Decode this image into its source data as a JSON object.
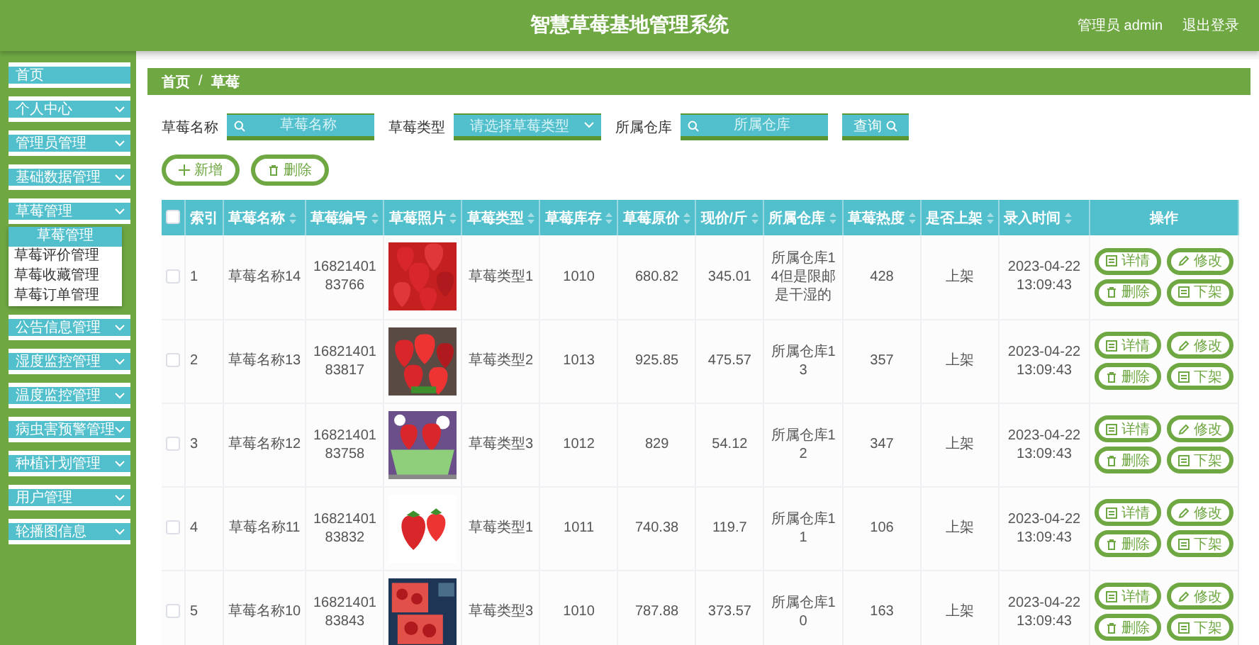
{
  "header": {
    "title": "智慧草莓基地管理系统",
    "user": "管理员 admin",
    "logout": "退出登录"
  },
  "sidebar": {
    "items": [
      {
        "label": "首页",
        "expandable": false
      },
      {
        "label": "个人中心",
        "expandable": true
      },
      {
        "label": "管理员管理",
        "expandable": true
      },
      {
        "label": "基础数据管理",
        "expandable": true
      },
      {
        "label": "草莓管理",
        "expandable": true,
        "children": [
          {
            "label": "草莓管理",
            "selected": true
          },
          {
            "label": "草莓评价管理",
            "selected": false
          },
          {
            "label": "草莓收藏管理",
            "selected": false
          },
          {
            "label": "草莓订单管理",
            "selected": false
          }
        ]
      },
      {
        "label": "公告信息管理",
        "expandable": true
      },
      {
        "label": "湿度监控管理",
        "expandable": true
      },
      {
        "label": "温度监控管理",
        "expandable": true
      },
      {
        "label": "病虫害预警管理",
        "expandable": true
      },
      {
        "label": "种植计划管理",
        "expandable": true
      },
      {
        "label": "用户管理",
        "expandable": true
      },
      {
        "label": "轮播图信息",
        "expandable": true
      }
    ]
  },
  "breadcrumb": {
    "items": [
      "首页",
      "草莓"
    ],
    "separator": "/"
  },
  "search": {
    "fields": [
      {
        "kind": "input",
        "label": "草莓名称",
        "placeholder": "草莓名称"
      },
      {
        "kind": "select",
        "label": "草莓类型",
        "placeholder": "请选择草莓类型"
      },
      {
        "kind": "input",
        "label": "所属仓库",
        "placeholder": "所属仓库"
      }
    ],
    "button": "查询"
  },
  "toolbar": [
    {
      "kind": "add",
      "label": "新增"
    },
    {
      "kind": "delete",
      "label": "删除"
    }
  ],
  "table": {
    "all_checked": false,
    "columns": [
      {
        "label": "索引",
        "sortable": false
      },
      {
        "label": "草莓名称",
        "sortable": true
      },
      {
        "label": "草莓编号",
        "sortable": true
      },
      {
        "label": "草莓照片",
        "sortable": true
      },
      {
        "label": "草莓类型",
        "sortable": true
      },
      {
        "label": "草莓库存",
        "sortable": true
      },
      {
        "label": "草莓原价",
        "sortable": true
      },
      {
        "label": "现价/斤",
        "sortable": true
      },
      {
        "label": "所属仓库",
        "sortable": true
      },
      {
        "label": "草莓热度",
        "sortable": true
      },
      {
        "label": "是否上架",
        "sortable": true
      },
      {
        "label": "录入时间",
        "sortable": true
      },
      {
        "label": "操作",
        "sortable": false
      }
    ],
    "rows": [
      {
        "checked": false,
        "cells": [
          "1",
          "草莓名称14",
          "1682140183766",
          {
            "kind": "picture"
          },
          "草莓类型1",
          "1010",
          "680.82",
          "345.01",
          "所属仓库14但是限邮是干湿的",
          "428",
          "上架",
          "2023-04-22 13:09:43"
        ],
        "actions": [
          {
            "kind": "detail",
            "label": "详情"
          },
          {
            "kind": "edit",
            "label": "修改"
          },
          {
            "kind": "delete",
            "label": "删除"
          },
          {
            "kind": "offshelf",
            "label": "下架"
          }
        ]
      },
      {
        "checked": false,
        "cells": [
          "2",
          "草莓名称13",
          "1682140183817",
          {
            "kind": "picture"
          },
          "草莓类型2",
          "1013",
          "925.85",
          "475.57",
          "所属仓库13",
          "357",
          "上架",
          "2023-04-22 13:09:43"
        ],
        "actions": [
          {
            "kind": "detail",
            "label": "详情"
          },
          {
            "kind": "edit",
            "label": "修改"
          },
          {
            "kind": "delete",
            "label": "删除"
          },
          {
            "kind": "offshelf",
            "label": "下架"
          }
        ]
      },
      {
        "checked": false,
        "cells": [
          "3",
          "草莓名称12",
          "1682140183758",
          {
            "kind": "picture"
          },
          "草莓类型3",
          "1012",
          "829",
          "54.12",
          "所属仓库12",
          "347",
          "上架",
          "2023-04-22 13:09:43"
        ],
        "actions": [
          {
            "kind": "detail",
            "label": "详情"
          },
          {
            "kind": "edit",
            "label": "修改"
          },
          {
            "kind": "delete",
            "label": "删除"
          },
          {
            "kind": "offshelf",
            "label": "下架"
          }
        ]
      },
      {
        "checked": false,
        "cells": [
          "4",
          "草莓名称11",
          "1682140183832",
          {
            "kind": "picture"
          },
          "草莓类型1",
          "1011",
          "740.38",
          "119.7",
          "所属仓库11",
          "106",
          "上架",
          "2023-04-22 13:09:43"
        ],
        "actions": [
          {
            "kind": "detail",
            "label": "详情"
          },
          {
            "kind": "edit",
            "label": "修改"
          },
          {
            "kind": "delete",
            "label": "删除"
          },
          {
            "kind": "offshelf",
            "label": "下架"
          }
        ]
      },
      {
        "checked": false,
        "cells": [
          "5",
          "草莓名称10",
          "1682140183843",
          {
            "kind": "picture"
          },
          "草莓类型3",
          "1010",
          "787.88",
          "373.57",
          "所属仓库10",
          "163",
          "上架",
          "2023-04-22 13:09:43"
        ],
        "actions": [
          {
            "kind": "detail",
            "label": "详情"
          },
          {
            "kind": "edit",
            "label": "修改"
          },
          {
            "kind": "delete",
            "label": "删除"
          },
          {
            "kind": "offshelf",
            "label": "下架"
          }
        ]
      }
    ]
  }
}
